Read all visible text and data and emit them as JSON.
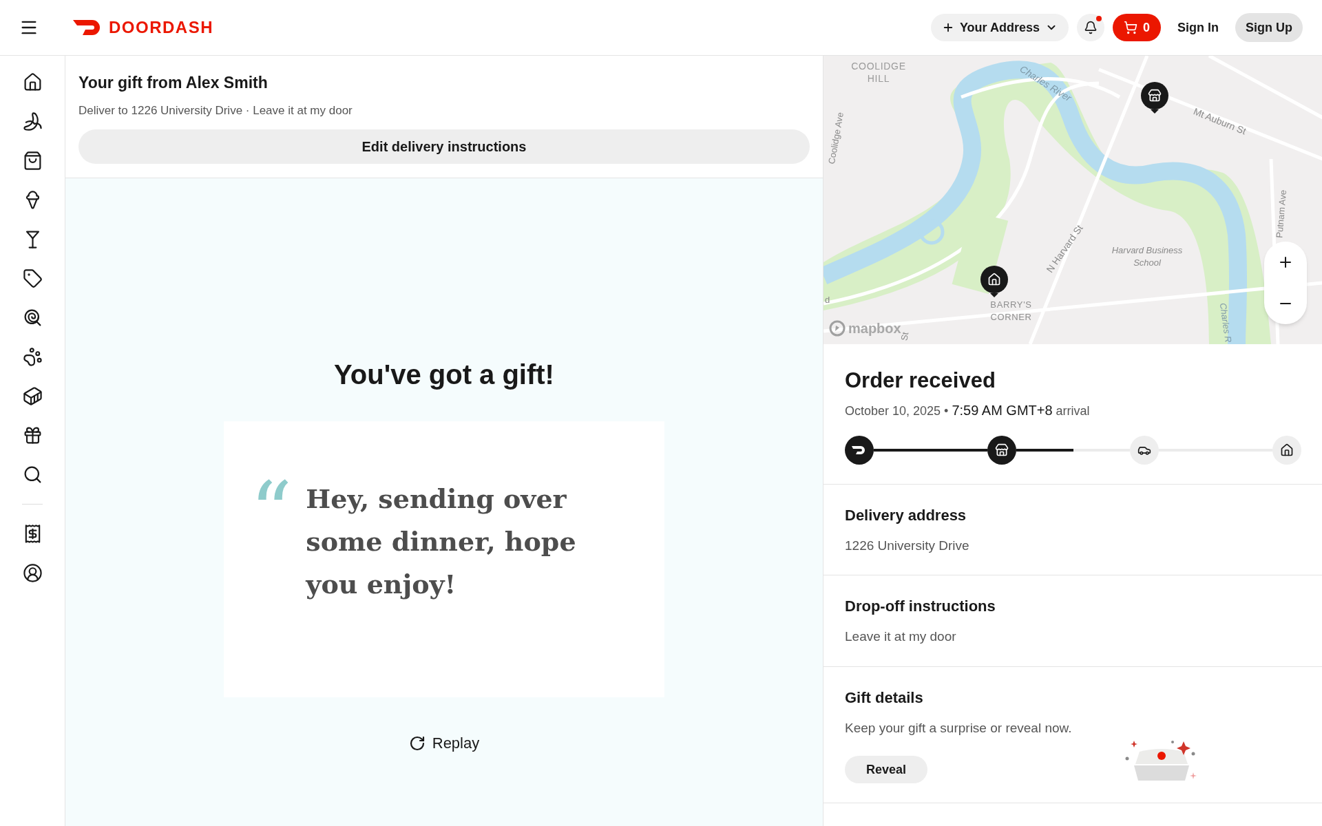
{
  "header": {
    "brand": "DOORDASH",
    "address_button": "Your Address",
    "notifications": {
      "unread": true
    },
    "cart_count": "0",
    "sign_in": "Sign In",
    "sign_up": "Sign Up"
  },
  "gift_banner": {
    "title": "Your gift from Alex Smith",
    "subtitle": "Deliver to 1226 University Drive · Leave it at my door",
    "button": "Edit delivery instructions"
  },
  "gift_message": {
    "heading": "You've got a gift!",
    "quote_mark": "“",
    "message": "Hey, sending over some dinner, hope you enjoy!",
    "replay": "Replay"
  },
  "map": {
    "labels": [
      "COOLIDGE HILL",
      "Coolidge Ave",
      "Charles River",
      "Mt Auburn St",
      "N Harvard St",
      "Harvard Business School",
      "Putnam Ave",
      "d",
      "BARRY'S CORNER",
      "Charles R",
      "St"
    ],
    "attribution": "mapbox"
  },
  "order_status": {
    "title": "Order received",
    "date": "October 10, 2025 •",
    "time": "7:59 AM GMT+8",
    "suffix": "arrival",
    "progress": {
      "current_leg": {
        "level": 0.5
      },
      "steps": [
        {
          "done": true
        },
        {
          "done": true
        },
        {
          "done": false
        },
        {
          "done": false
        }
      ]
    }
  },
  "sections": [
    {
      "title": "Delivery address",
      "text": "1226 University Drive"
    },
    {
      "title": "Drop-off instructions",
      "text": "Leave it at my door"
    },
    {
      "title": "Gift details",
      "text": "Keep your gift a surprise or reveal now.",
      "button": "Reveal"
    }
  ]
}
